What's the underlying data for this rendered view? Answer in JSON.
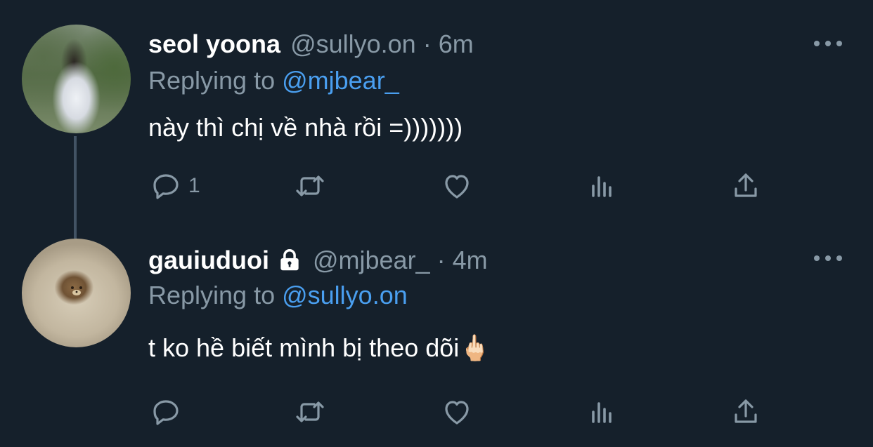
{
  "tweets": [
    {
      "name": "seol yoona",
      "handle": "@sullyo.on",
      "separator": "·",
      "time": "6m",
      "replying_prefix": "Replying to ",
      "replying_to": "@mjbear_",
      "text": "này thì chị về nhà rồi =)))))))",
      "reply_count": "1",
      "protected": false
    },
    {
      "name": "gauiuduoi",
      "handle": "@mjbear_",
      "separator": "·",
      "time": "4m",
      "replying_prefix": "Replying to ",
      "replying_to": "@sullyo.on",
      "text": "t ko hề biết mình bị theo dõi🖕🏻",
      "reply_count": "",
      "protected": true
    }
  ],
  "colors": {
    "background": "#15202b",
    "primary_text": "#ffffff",
    "secondary_text": "#8899a6",
    "link": "#4a9ff0",
    "thread_line": "#425364"
  },
  "icons": [
    "reply-icon",
    "retweet-icon",
    "like-icon",
    "analytics-icon",
    "share-icon",
    "more-icon",
    "lock-icon"
  ]
}
